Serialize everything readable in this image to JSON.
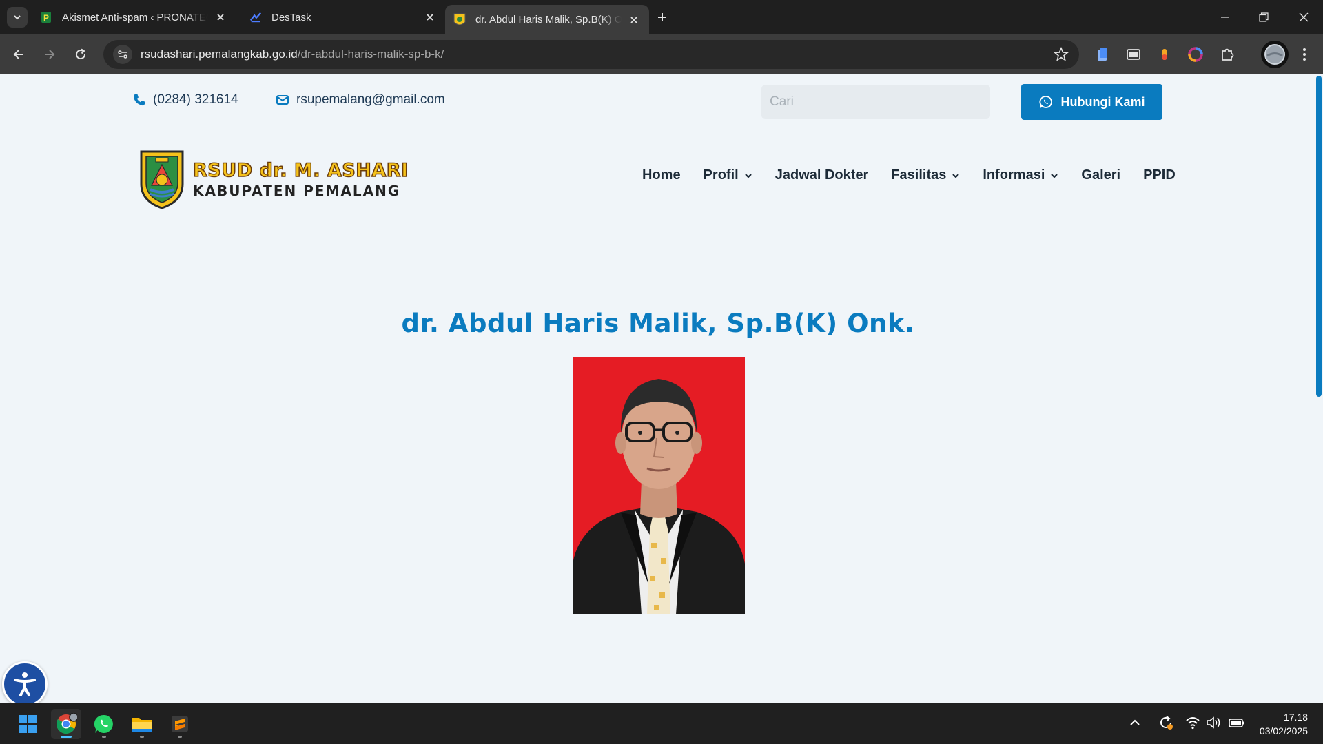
{
  "browser": {
    "tabs": [
      {
        "title": "Akismet Anti-spam ‹ PRONATEC",
        "favicon": "pronatec-icon"
      },
      {
        "title": "DesTask",
        "favicon": "destask-icon"
      },
      {
        "title": "dr. Abdul Haris Malik, Sp.B(K) Onk.",
        "favicon": "rsud-logo-icon",
        "active": true
      }
    ],
    "url_domain": "rsudashari.pemalangkab.go.id",
    "url_path": "/dr-abdul-haris-malik-sp-b-k/"
  },
  "site": {
    "phone": "(0284) 321614",
    "email": "rsupemalang@gmail.com",
    "search_placeholder": "Cari",
    "contact_button": "Hubungi Kami",
    "logo_line1": "RSUD dr. M. ASHARI",
    "logo_line2": "KABUPATEN PEMALANG",
    "nav": [
      {
        "label": "Home",
        "dropdown": false
      },
      {
        "label": "Profil",
        "dropdown": true
      },
      {
        "label": "Jadwal Dokter",
        "dropdown": false
      },
      {
        "label": "Fasilitas",
        "dropdown": true
      },
      {
        "label": "Informasi",
        "dropdown": true
      },
      {
        "label": "Galeri",
        "dropdown": false
      },
      {
        "label": "PPID",
        "dropdown": false
      }
    ],
    "doctor_name": "dr. Abdul Haris Malik, Sp.B(K) Onk.",
    "colors": {
      "primary": "#0a7bbf",
      "photo_background": "#e51c24",
      "page_background": "#f0f5f9"
    }
  },
  "taskbar": {
    "time": "17.18",
    "date": "03/02/2025",
    "apps": [
      "windows-start-icon",
      "chrome-icon",
      "whatsapp-icon",
      "file-explorer-icon",
      "sublime-text-icon"
    ]
  }
}
